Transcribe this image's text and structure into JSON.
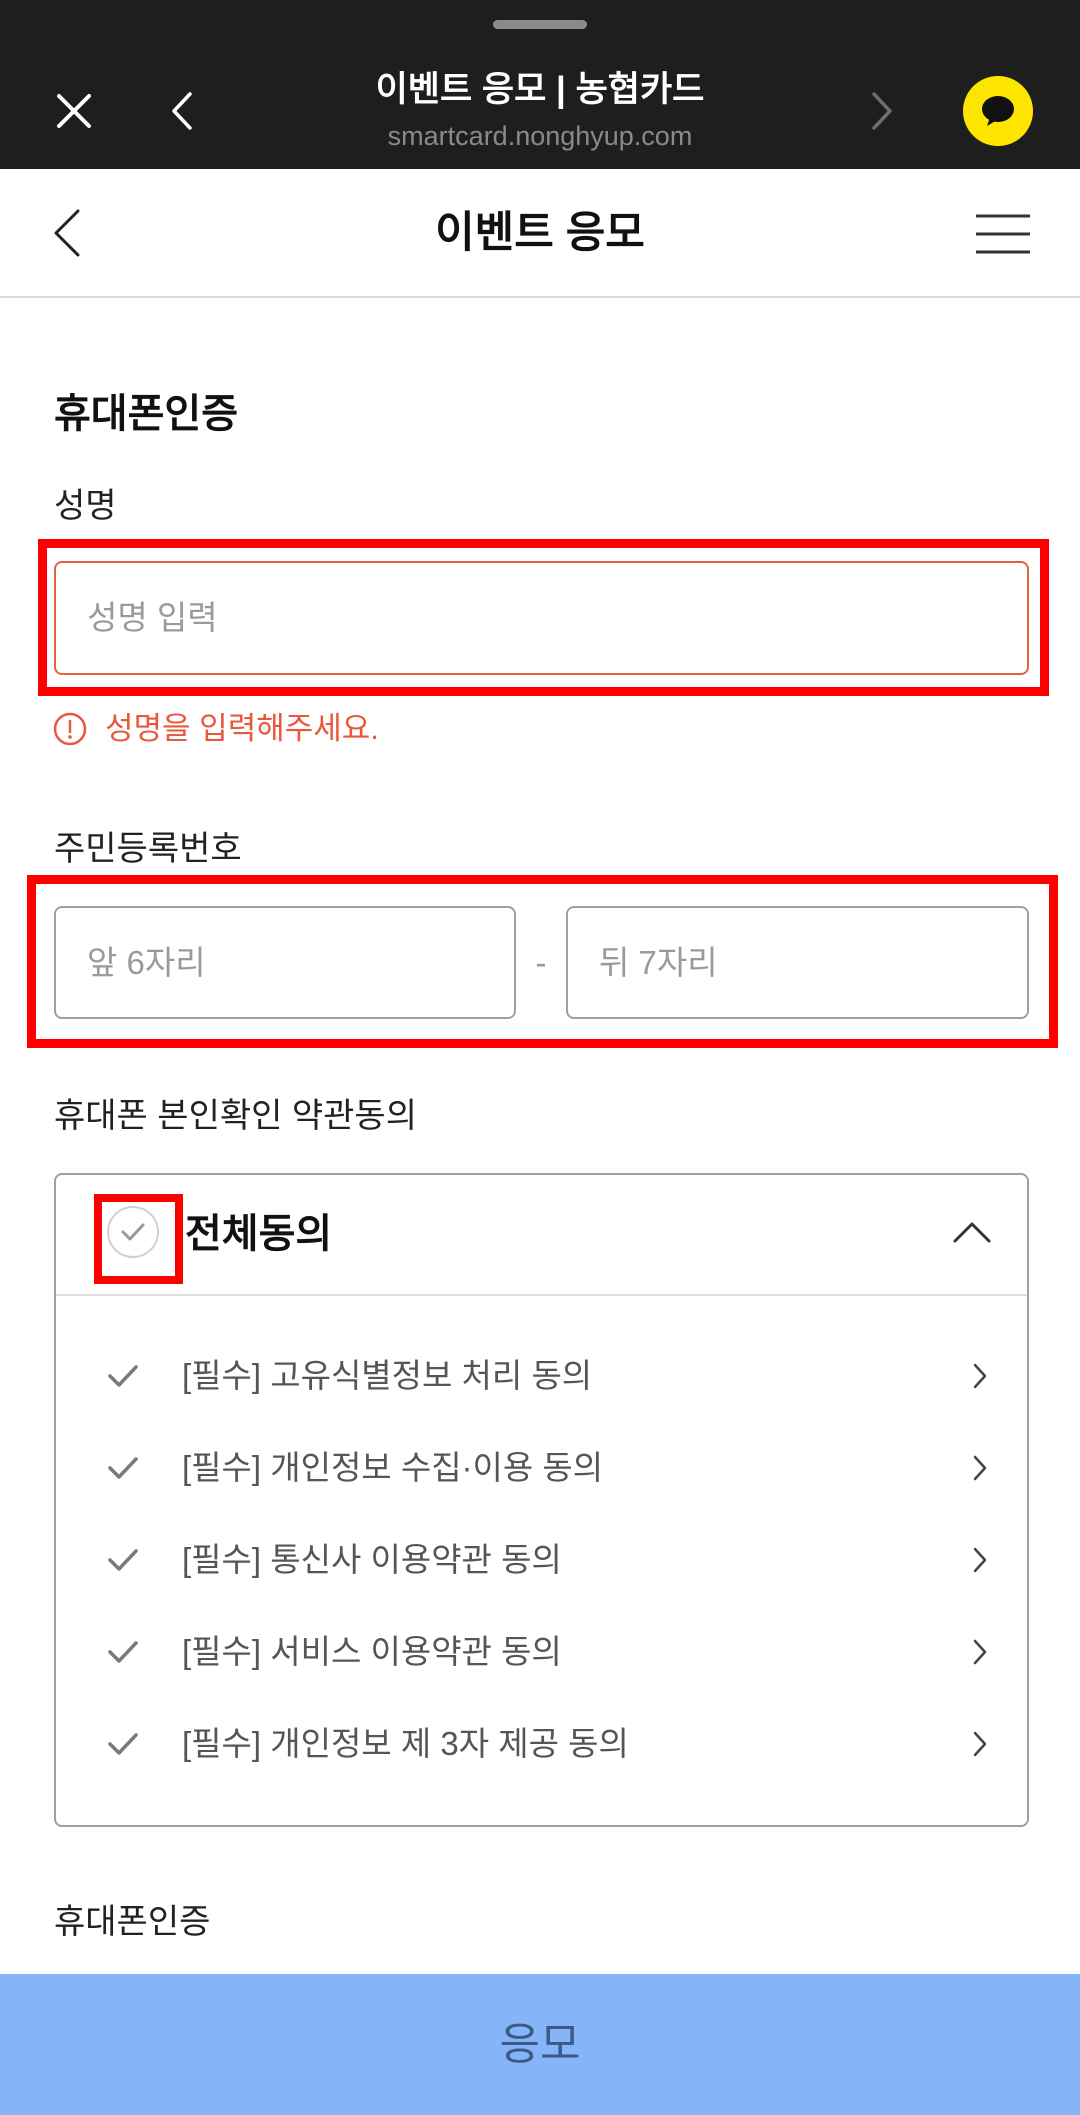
{
  "browser_bar": {
    "title": "이벤트 응모 | 농협카드",
    "url": "smartcard.nonghyup.com"
  },
  "header": {
    "title": "이벤트 응모"
  },
  "form": {
    "heading": "휴대폰인증",
    "name": {
      "label": "성명",
      "placeholder": "성명 입력",
      "error": "성명을 입력해주세요."
    },
    "rrn": {
      "label": "주민등록번호",
      "front_placeholder": "앞 6자리",
      "separator": "-",
      "back_placeholder": "뒤 7자리"
    },
    "terms": {
      "label": "휴대폰 본인확인 약관동의",
      "agree_all": "전체동의",
      "items": [
        "[필수] 고유식별정보 처리 동의",
        "[필수] 개인정보 수집·이용 동의",
        "[필수] 통신사 이용약관 동의",
        "[필수] 서비스 이용약관 동의",
        "[필수] 개인정보 제 3자 제공 동의"
      ]
    },
    "next_section_label": "휴대폰인증"
  },
  "submit": {
    "label": "응모"
  },
  "colors": {
    "browser_bar_bg": "#1e1e1e",
    "kakao_yellow": "#fee500",
    "error": "#e9573d",
    "highlight": "#ff0000",
    "submit_bg": "#86b4f8",
    "submit_text": "#3b5a86"
  },
  "icons": {
    "browser_bar": [
      "close-icon",
      "back-icon",
      "forward-icon",
      "kakaotalk-icon"
    ],
    "header": [
      "back-icon",
      "hamburger-menu-icon"
    ],
    "form": [
      "alert-circle-icon",
      "check-circle-icon",
      "chevron-up-icon",
      "check-icon",
      "chevron-right-icon"
    ]
  }
}
